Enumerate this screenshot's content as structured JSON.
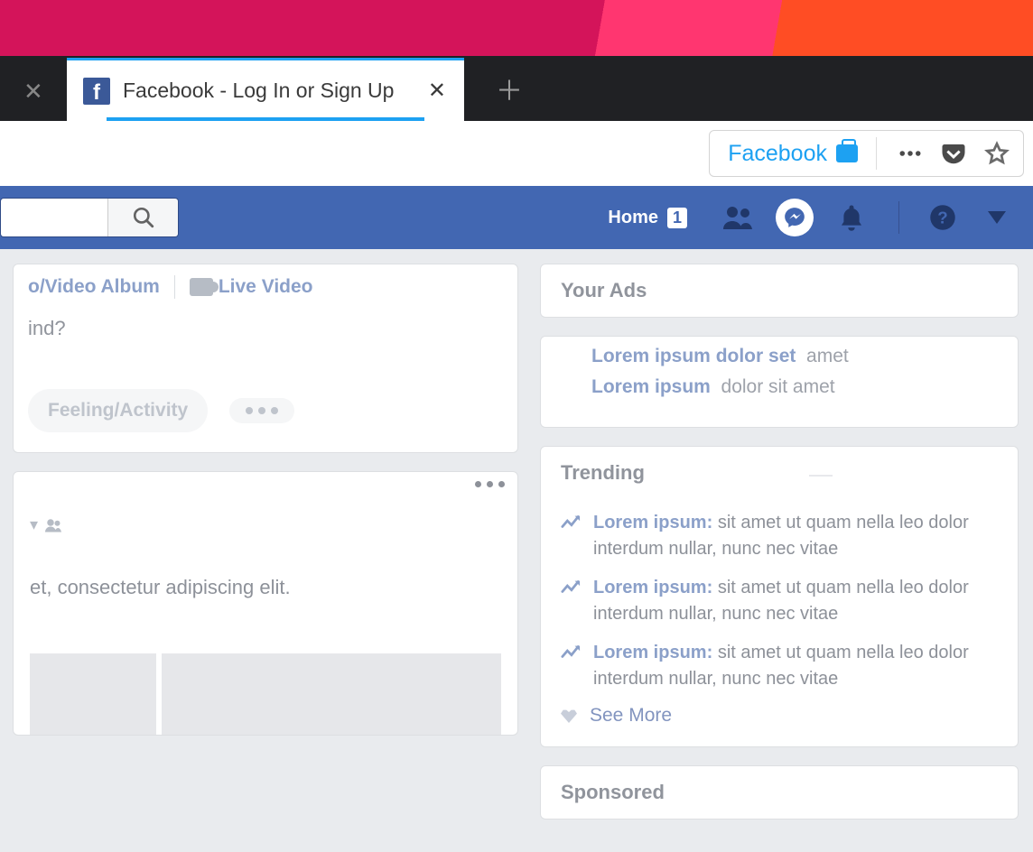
{
  "browser": {
    "tab_title": "Facebook - Log In or Sign Up",
    "site_identity": "Facebook"
  },
  "fb_nav": {
    "home_label": "Home",
    "home_badge": "1"
  },
  "composer": {
    "tab_album": "o/Video Album",
    "tab_live": "Live Video",
    "prompt": "ind?",
    "action_feeling": "Feeling/Activity"
  },
  "post": {
    "text": "et, consectetur adipiscing elit."
  },
  "side": {
    "ads_title": "Your Ads",
    "ad1_bold": "Lorem ipsum dolor set",
    "ad1_rest": "amet",
    "ad2_bold": "Lorem ipsum",
    "ad2_rest": "dolor sit amet",
    "trending_title": "Trending",
    "t1_bold": "Lorem ipsum:",
    "t1_rest": "sit amet ut quam nella leo dolor interdum nullar, nunc nec vitae",
    "t2_bold": "Lorem ipsum:",
    "t2_rest": "sit amet ut quam nella leo dolor interdum nullar, nunc nec vitae",
    "t3_bold": "Lorem ipsum:",
    "t3_rest": "sit amet ut quam nella leo dolor interdum nullar, nunc nec vitae",
    "see_more": "See More",
    "sponsored_title": "Sponsored"
  }
}
